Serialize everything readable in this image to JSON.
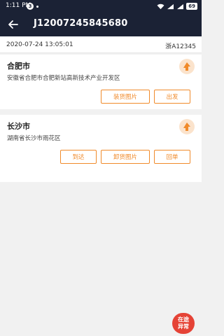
{
  "status_bar": {
    "time": "1:11 PM",
    "notification_count": "3",
    "battery": "69"
  },
  "header": {
    "title": "J12007245845680",
    "back_icon": "arrow-left-icon"
  },
  "order_info": {
    "date": "2020-07-24 13:05:01",
    "plate": "浙A12345"
  },
  "stops": [
    {
      "city": "合肥市",
      "address": "安徽省合肥市合肥新站高新技术产业开发区",
      "nav_icon": "navigation-arrow-icon",
      "buttons": [
        "装货图片",
        "出发"
      ]
    },
    {
      "city": "长沙市",
      "address": "湖南省长沙市雨花区",
      "nav_icon": "navigation-arrow-icon",
      "buttons": [
        "到达",
        "卸货图片",
        "回单"
      ]
    }
  ],
  "fab": {
    "line1": "在途",
    "line2": "异常"
  },
  "colors": {
    "header_bg": "#1b2235",
    "accent": "#f08a2a",
    "fab_bg": "#e54336"
  }
}
